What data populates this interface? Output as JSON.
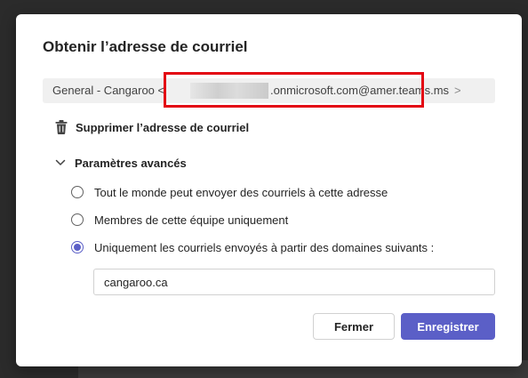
{
  "dialog": {
    "title": "Obtenir l’adresse de courriel",
    "email": {
      "prefix": "General - Cangaroo <",
      "redacted_placeholder": "",
      "domain": ".onmicrosoft.com@amer.teams.ms",
      "suffix": ">"
    },
    "delete_label": "Supprimer l’adresse de courriel",
    "advanced_label": "Paramètres avancés",
    "options": [
      {
        "label": "Tout le monde peut envoyer des courriels à cette adresse",
        "checked": false
      },
      {
        "label": "Membres de cette équipe uniquement",
        "checked": false
      },
      {
        "label": "Uniquement les courriels envoyés à partir des domaines suivants :",
        "checked": true
      }
    ],
    "domains_value": "cangaroo.ca",
    "close_label": "Fermer",
    "save_label": "Enregistrer"
  },
  "colors": {
    "accent": "#5b5fc7",
    "highlight": "#e30613",
    "email_box_bg": "#f0f0f0",
    "backdrop": "#2b2b2b"
  },
  "icons": {
    "delete": "trash-icon",
    "advanced": "chevron-down-icon"
  }
}
